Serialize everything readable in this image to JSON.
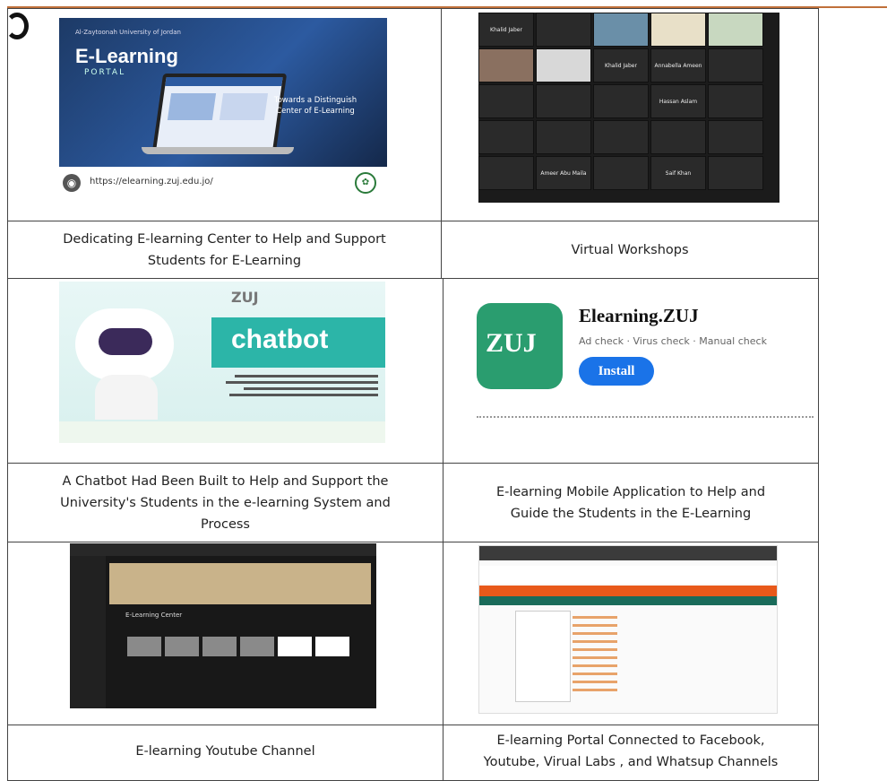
{
  "cells": [
    {
      "caption_lines": [
        "Dedicating E-learning Center to Help and Support",
        "Students for E-Learning"
      ]
    },
    {
      "caption_lines": [
        "Virtual Workshops"
      ]
    },
    {
      "caption_lines": [
        "A Chatbot Had Been Built to Help and Support the",
        "University's Students in the e-learning System and",
        "Process"
      ]
    },
    {
      "caption_lines": [
        "E-learning Mobile Application to Help and",
        "Guide the Students in the E-Learning"
      ]
    },
    {
      "caption_lines": [
        "E-learning Youtube Channel"
      ]
    },
    {
      "caption_lines": [
        "E-learning Portal Connected to Facebook,",
        "Youtube, Virual Labs , and Whatsup Channels"
      ]
    }
  ],
  "portal": {
    "tagline": "Al-Zaytoonah University of Jordan",
    "title": "E-Learning",
    "subtitle": "PORTAL",
    "towards": "Towards a Distinguish Center of E-Learning",
    "url": "https://elearning.zuj.edu.jo/",
    "globe_icon": "globe-icon"
  },
  "meeting": {
    "names": [
      "Khalid Jaber",
      "Khalid Jaber",
      "Annabella Ameen",
      "Hassan Aslam",
      "Ameer Abu Maila",
      "Saif Khan"
    ]
  },
  "chatbot": {
    "brand": "ZUJ",
    "word": "chatbot"
  },
  "app": {
    "name": "Elearning.ZUJ",
    "checks": "Ad check · Virus check · Manual check",
    "install_label": "Install",
    "icon_text": "ZUJ",
    "icon_color": "#2a9d6f",
    "install_color": "#1a73e8"
  },
  "youtube": {
    "channel": "E-Learning Center"
  }
}
